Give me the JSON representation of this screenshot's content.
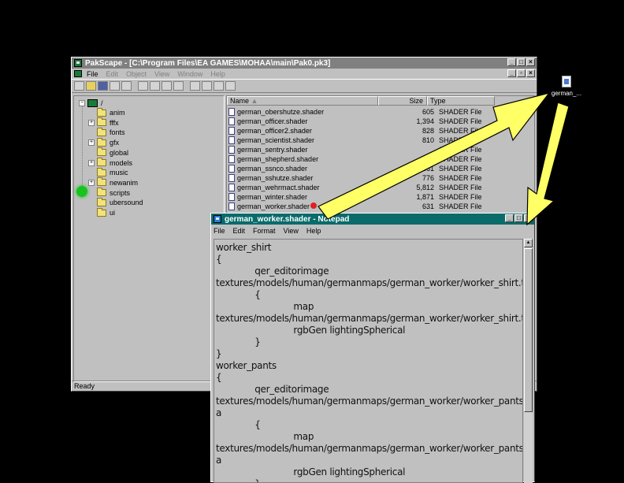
{
  "pakscape": {
    "title": "PakScape - [C:\\Program Files\\EA GAMES\\MOHAA\\main\\Pak0.pk3]",
    "menu": [
      "File",
      "Edit",
      "Object",
      "View",
      "Window",
      "Help"
    ],
    "status": "Ready",
    "tree_root": "/",
    "tree": [
      {
        "label": "anim",
        "expand": false
      },
      {
        "label": "fffx",
        "expand": true
      },
      {
        "label": "fonts",
        "expand": false
      },
      {
        "label": "gfx",
        "expand": true
      },
      {
        "label": "global",
        "expand": false
      },
      {
        "label": "models",
        "expand": true
      },
      {
        "label": "music",
        "expand": false
      },
      {
        "label": "newanim",
        "expand": true
      },
      {
        "label": "scripts",
        "expand": false
      },
      {
        "label": "ubersound",
        "expand": false
      },
      {
        "label": "ui",
        "expand": false
      }
    ],
    "columns": {
      "name": "Name",
      "size": "Size",
      "type": "Type"
    },
    "files": [
      {
        "name": "german_obershutze.shader",
        "size": "605",
        "type": "SHADER File"
      },
      {
        "name": "german_officer.shader",
        "size": "1,394",
        "type": "SHADER File"
      },
      {
        "name": "german_officer2.shader",
        "size": "828",
        "type": "SHADER File"
      },
      {
        "name": "german_scientist.shader",
        "size": "810",
        "type": "SHADER File"
      },
      {
        "name": "german_sentry.shader",
        "size": "",
        "type": "SHADER File"
      },
      {
        "name": "german_shepherd.shader",
        "size": "",
        "type": "SHADER File"
      },
      {
        "name": "german_ssnco.shader",
        "size": "861",
        "type": "SHADER File"
      },
      {
        "name": "german_sshutze.shader",
        "size": "776",
        "type": "SHADER File"
      },
      {
        "name": "german_wehrmact.shader",
        "size": "5,812",
        "type": "SHADER File"
      },
      {
        "name": "german_winter.shader",
        "size": "1,871",
        "type": "SHADER File"
      },
      {
        "name": "german_worker.shader",
        "size": "631",
        "type": "SHADER File"
      }
    ]
  },
  "notepad": {
    "title": "german_worker.shader - Notepad",
    "menu": [
      "File",
      "Edit",
      "Format",
      "View",
      "Help"
    ],
    "lines": [
      "worker_shirt",
      "{",
      "              qer_editorimage",
      "textures/models/human/germanmaps/german_worker/worker_shirt.tga",
      "              {",
      "                            map",
      "textures/models/human/germanmaps/german_worker/worker_shirt.tga",
      "                            rgbGen lightingSpherical",
      "              }",
      "}",
      "worker_pants",
      "{",
      "              qer_editorimage",
      "textures/models/human/germanmaps/german_worker/worker_pants.tg",
      "a",
      "              {",
      "                            map",
      "textures/models/human/germanmaps/german_worker/worker_pants.tg",
      "a",
      "                            rgbGen lightingSpherical",
      "              }"
    ]
  },
  "desktop_icon": {
    "label": "german_..."
  },
  "colors": {
    "arrow": "#ffff66",
    "notepad_title": "#0a6b6b",
    "marker_red": "#e02020",
    "marker_green": "#19c31f"
  }
}
